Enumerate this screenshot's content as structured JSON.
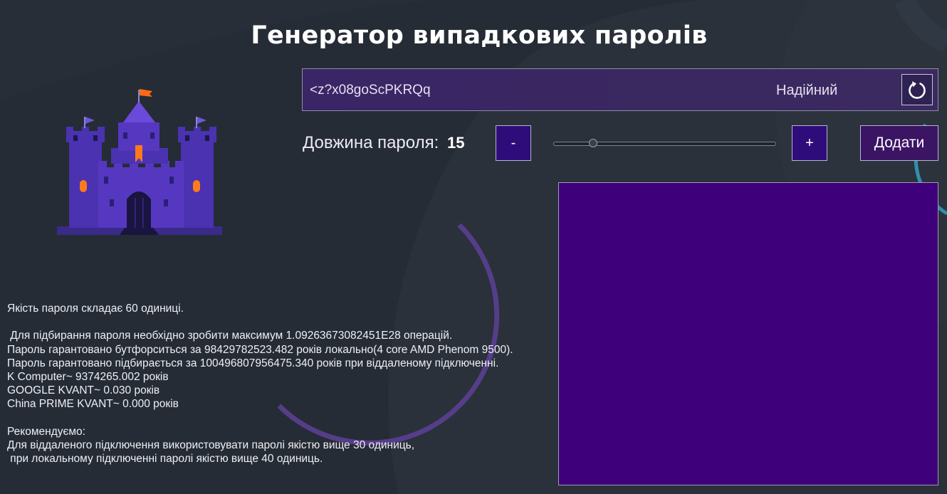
{
  "app": {
    "title": "Генератор випадкових паролів"
  },
  "password": {
    "value": "<z?x08goScPKRQq",
    "strength": "Надійний",
    "refresh_icon": "refresh-icon"
  },
  "length": {
    "label": "Довжина пароля:",
    "value": "15",
    "slider_fraction": 0.18,
    "minus_label": "-",
    "plus_label": "+"
  },
  "actions": {
    "add_label": "Додати"
  },
  "saved_list": {
    "items": []
  },
  "info": {
    "lines": [
      "Якість пароля складає 60 одиниці.",
      "",
      " Для підбирання пароля необхідно зробити максимум 1.09263673082451E28 операцій.",
      "Пароль гарантовано бутфорситься за 98429782523.482 років локально(4 core AMD Phenom 9500).",
      "Пароль гарантовано підбирається за 100496807956475.340 років при віддаленому підключенні.",
      "K Computer~ 9374265.002 років",
      "GOOGLE KVANT~ 0.030 років",
      "China PRIME KVANT~ 0.000 років",
      "",
      "Рекомендуємо:",
      "Для віддаленого підключення використовувати паролі якістю вище 30 одиниць,",
      " при локальному підключенні паролі якістю вище 40 одиниць."
    ]
  },
  "colors": {
    "background": "#252c35",
    "accent": "#3f007b",
    "button": "#2e0d7a",
    "ring": "#6a4aa8",
    "ring_teal": "#2f8fb0"
  },
  "icons": {
    "castle": "castle-icon",
    "refresh": "refresh-icon"
  }
}
